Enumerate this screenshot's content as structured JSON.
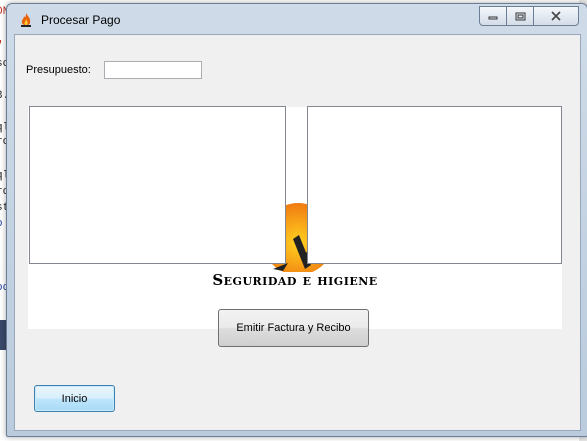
{
  "window": {
    "title": "Procesar Pago"
  },
  "form": {
    "budget_label": "Presupuesto:",
    "budget_value": "",
    "logo_caption": "Seguridad e higiene",
    "emit_button": "Emitir Factura y Recibo",
    "home_button": "Inicio"
  },
  "background_app": {
    "code_fragments": [
      "ON",
      "\"",
      "sc",
      "3.",
      "ql",
      "ro",
      "ql",
      "ro",
      "st",
      "o",
      "oo"
    ]
  },
  "icons": {
    "app": "flame-logo-icon",
    "minimize": "minimize-icon",
    "maximize": "maximize-icon",
    "close": "close-icon"
  }
}
